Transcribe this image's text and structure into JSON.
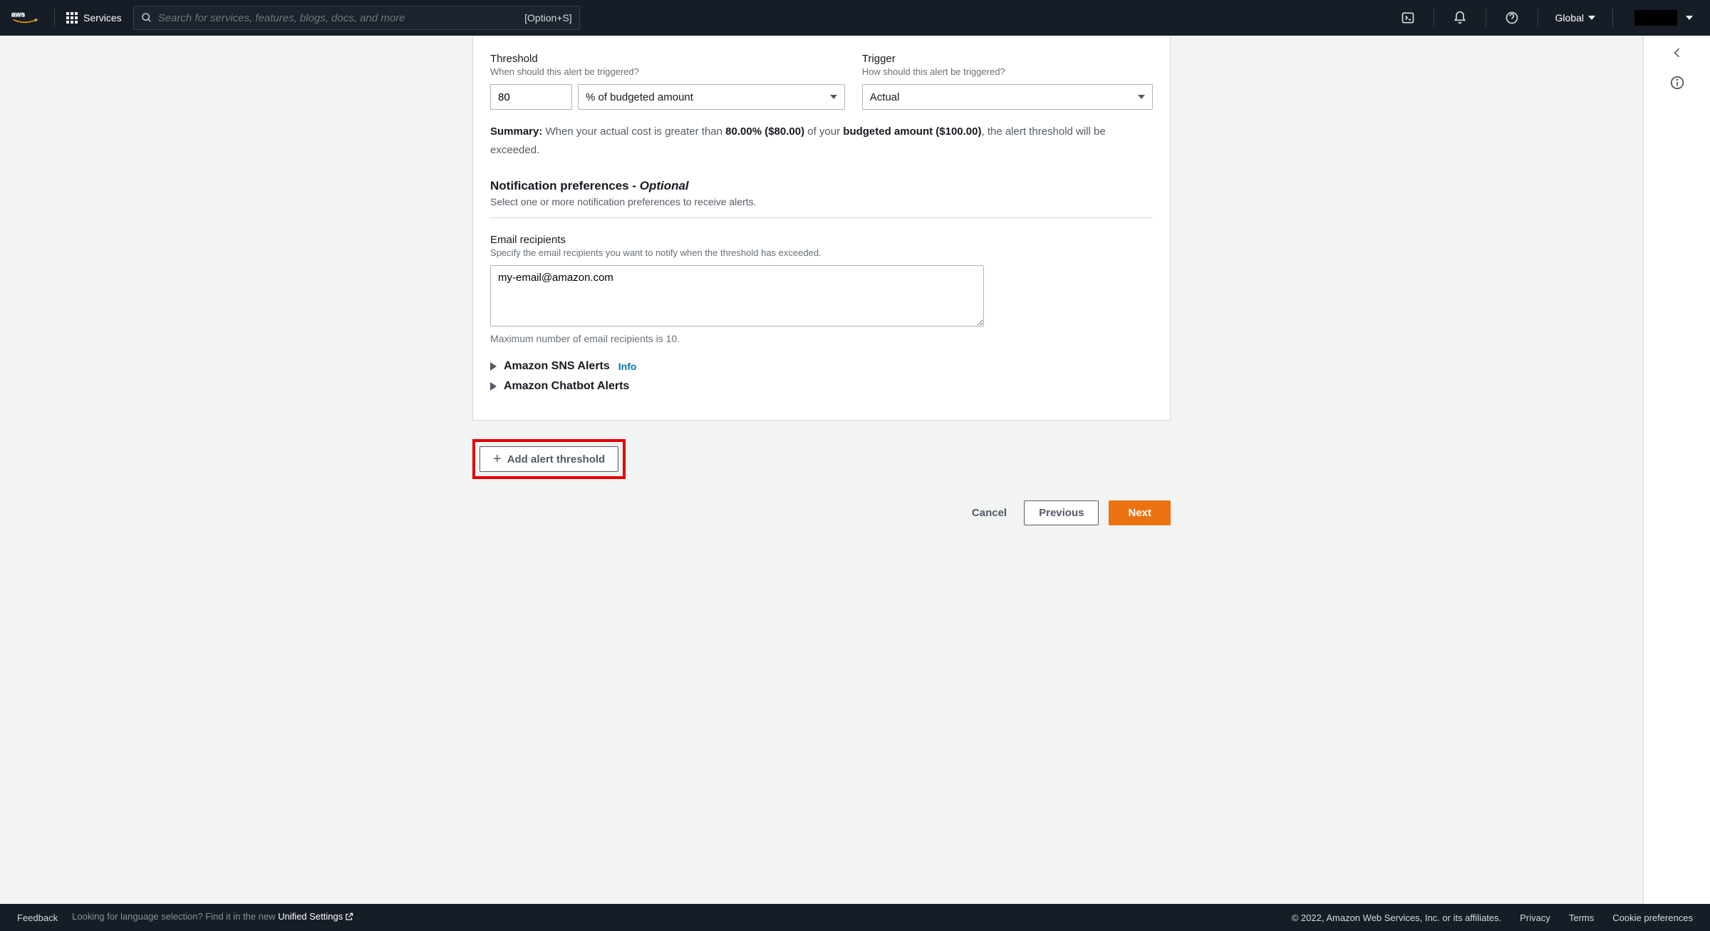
{
  "topnav": {
    "services_label": "Services",
    "search_placeholder": "Search for services, features, blogs, docs, and more",
    "hotkey": "[Option+S]",
    "region": "Global"
  },
  "form": {
    "threshold": {
      "label": "Threshold",
      "sub": "When should this alert be triggered?",
      "value": "80",
      "unit": "% of budgeted amount"
    },
    "trigger": {
      "label": "Trigger",
      "sub": "How should this alert be triggered?",
      "value": "Actual"
    },
    "summary": {
      "prefix": "Summary:",
      "t1": " When your actual cost is greater than ",
      "pct": "80.00% ($80.00)",
      "t2": " of your ",
      "budget": "budgeted amount ($100.00)",
      "t3": ", the alert threshold will be exceeded."
    },
    "notif": {
      "title": "Notification preferences - ",
      "optional": "Optional",
      "sub": "Select one or more notification preferences to receive alerts."
    },
    "email": {
      "label": "Email recipients",
      "sub": "Specify the email recipients you want to notify when the threshold has exceeded.",
      "value": "my-email@amazon.com",
      "hint": "Maximum number of email recipients is 10."
    },
    "sns": {
      "label": "Amazon SNS Alerts",
      "info": "Info"
    },
    "chatbot": {
      "label": "Amazon Chatbot Alerts"
    },
    "add_button": "Add alert threshold",
    "actions": {
      "cancel": "Cancel",
      "previous": "Previous",
      "next": "Next"
    }
  },
  "footer": {
    "feedback": "Feedback",
    "lang_prompt": "Looking for language selection? Find it in the new ",
    "unified": "Unified Settings",
    "copyright": "© 2022, Amazon Web Services, Inc. or its affiliates.",
    "privacy": "Privacy",
    "terms": "Terms",
    "cookies": "Cookie preferences"
  }
}
